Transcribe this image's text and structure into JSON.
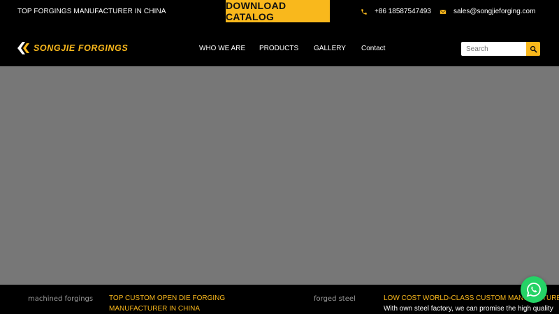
{
  "header": {
    "tagline": "TOP FORGINGS MANUFACTURER IN CHINA",
    "catalog_button": "DOWNLOAD CATALOG",
    "phone": "+86 18587547493",
    "email": "sales@songjieforging.com",
    "phone_icon": "phone-icon",
    "email_icon": "envelope-icon"
  },
  "brand": {
    "name": "SONGJIE FORGINGS",
    "color": "#f9b81c"
  },
  "nav": {
    "items": [
      "WHO WE ARE",
      "PRODUCTS",
      "GALLERY",
      "Contact"
    ]
  },
  "search": {
    "placeholder": "Search",
    "icon": "search-icon"
  },
  "strip": {
    "image1_alt": "machined forgings",
    "title1": "TOP CUSTOM OPEN DIE FORGING MANUFACTURER IN CHINA",
    "image2_alt": "forged steel",
    "title2": "LOW COST WORLD-CLASS CUSTOM MANUFACTURER",
    "desc2": "With own steel factory, we can promise the high quality"
  },
  "floating": {
    "icon": "whatsapp-icon"
  }
}
